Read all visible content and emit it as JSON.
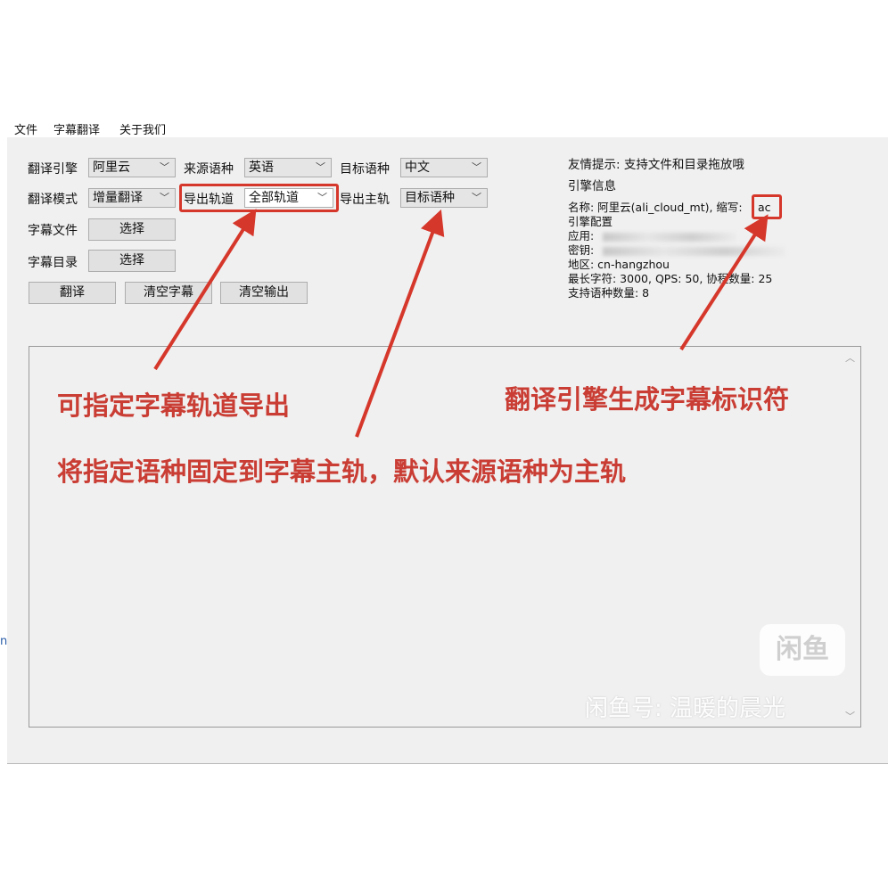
{
  "menu": [
    "文件",
    "字幕翻译",
    "关于我们"
  ],
  "form": {
    "engine_label": "翻译引擎",
    "engine_value": "阿里云",
    "source_label": "来源语种",
    "source_value": "英语",
    "target_label": "目标语种",
    "target_value": "中文",
    "mode_label": "翻译模式",
    "mode_value": "增量翻译",
    "track_label": "导出轨道",
    "track_value": "全部轨道",
    "main_track_label": "导出主轨",
    "main_track_value": "目标语种",
    "sub_file_label": "字幕文件",
    "sub_dir_label": "字幕目录",
    "choose_label": "选择"
  },
  "buttons": {
    "translate": "翻译",
    "clear_subs": "清空字幕",
    "clear_output": "清空输出"
  },
  "info": {
    "tip": "友情提示: 支持文件和目录拖放哦",
    "engine_info_title": "引擎信息",
    "name_line": "名称: 阿里云(ali_cloud_mt), 缩写:",
    "abbr": "ac",
    "config_title": "引擎配置",
    "app_label": "应用:",
    "key_label": "密钥:",
    "region_line": "地区: cn-hangzhou",
    "limits_line": "最长字符: 3000, QPS: 50, 协程数量: 25",
    "lang_count_line": "支持语种数量: 8"
  },
  "annotations": {
    "track_note": "可指定字幕轨道导出",
    "main_track_note": "将指定语种固定到字幕主轨，默认来源语种为主轨",
    "abbr_note": "翻译引擎生成字幕标识符"
  },
  "watermark": {
    "logo": "闲鱼",
    "text": "闲鱼号: 温暖的晨光"
  },
  "colors": {
    "annotation_red": "#d6372b",
    "window_bg": "#f0f0f0"
  },
  "icons": [
    "chevron-down-icon",
    "scroll-up-icon",
    "scroll-down-icon",
    "arrow-icon"
  ]
}
